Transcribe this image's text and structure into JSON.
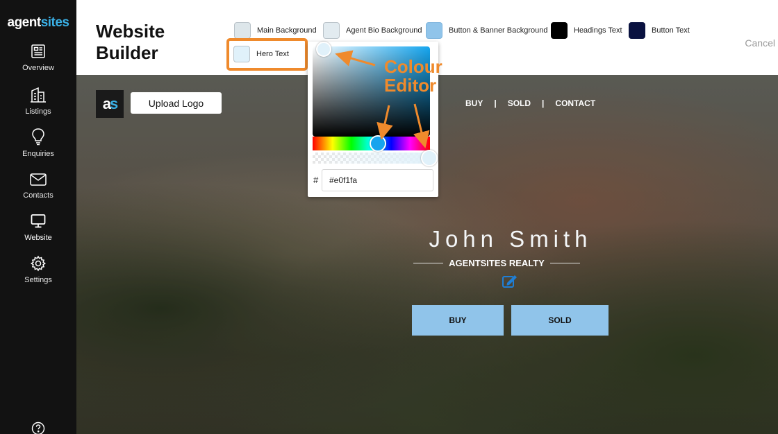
{
  "brand": {
    "part1": "agent",
    "part2": "sites"
  },
  "sidebar": {
    "items": [
      {
        "label": "Overview",
        "icon": "newspaper-icon"
      },
      {
        "label": "Listings",
        "icon": "buildings-icon"
      },
      {
        "label": "Enquiries",
        "icon": "lightbulb-icon"
      },
      {
        "label": "Contacts",
        "icon": "envelope-icon"
      },
      {
        "label": "Website",
        "icon": "monitor-icon",
        "active": true
      },
      {
        "label": "Settings",
        "icon": "gear-icon"
      }
    ],
    "help_icon": "help-icon"
  },
  "header": {
    "title": "Website Builder",
    "cancel_label": "Cancel",
    "swatches": [
      {
        "label": "Main Background",
        "color": "#dde6ea"
      },
      {
        "label": "Agent Bio Background",
        "color": "#e2ebf0"
      },
      {
        "label": "Button & Banner Background",
        "color": "#90c4ea"
      },
      {
        "label": "Headings Text",
        "color": "#000000"
      },
      {
        "label": "Button Text",
        "color": "#0a1240"
      },
      {
        "label": "Hero Text",
        "color": "#e0f1fa"
      }
    ]
  },
  "colour_editor": {
    "hash_symbol": "#",
    "hex_value": "#e0f1fa",
    "annotation_line1": "Colour",
    "annotation_line2": "Editor",
    "annotation_color": "#ef8a2c"
  },
  "hero": {
    "logo_text_a": "a",
    "logo_text_s": "s",
    "upload_logo_label": "Upload Logo",
    "nav": [
      "BUY",
      "SOLD",
      "CONTACT"
    ],
    "nav_separator": "|",
    "agent_name": "John Smith",
    "agency": "AGENTSITES REALTY",
    "buttons": [
      "BUY",
      "SOLD"
    ],
    "button_color": "#90c4ea"
  }
}
